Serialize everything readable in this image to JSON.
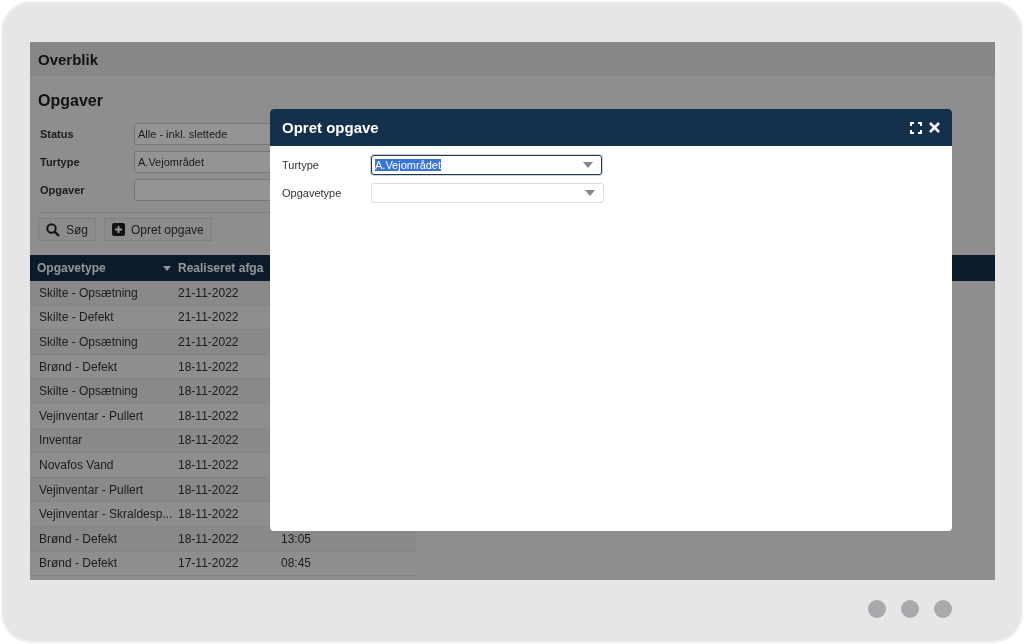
{
  "page": {
    "title": "Overblik",
    "section_title": "Opgaver"
  },
  "filters": [
    {
      "label": "Status",
      "value": "Alle - inkl. slettede"
    },
    {
      "label": "Turtype",
      "value": "A.Vejområdet"
    },
    {
      "label": "Opgaver"
    }
  ],
  "buttons": [
    {
      "label": "Søg",
      "kind": "search"
    },
    {
      "label": "Opret opgave",
      "kind": "add"
    }
  ],
  "table": {
    "columns": [
      {
        "label": "Opgavetype"
      },
      {
        "label": "Realiseret afga"
      }
    ],
    "rows": [
      {
        "opgavetype": "Skilte - Opsætning",
        "date": "21-11-2022"
      },
      {
        "opgavetype": "Skilte - Defekt",
        "date": "21-11-2022"
      },
      {
        "opgavetype": "Skilte - Opsætning",
        "date": "21-11-2022"
      },
      {
        "opgavetype": "Brønd - Defekt",
        "date": "18-11-2022"
      },
      {
        "opgavetype": "Skilte - Opsætning",
        "date": "18-11-2022"
      },
      {
        "opgavetype": "Vejinventar - Pullert",
        "date": "18-11-2022"
      },
      {
        "opgavetype": "Inventar",
        "date": "18-11-2022"
      },
      {
        "opgavetype": "Novafos Vand",
        "date": "18-11-2022"
      },
      {
        "opgavetype": "Vejinventar - Pullert",
        "date": "18-11-2022"
      },
      {
        "opgavetype": "Vejinventar - Skraldesp...",
        "date": "18-11-2022"
      },
      {
        "opgavetype": "Brønd - Defekt",
        "date": "18-11-2022",
        "column_3": "13:05"
      },
      {
        "opgavetype": "Brønd - Defekt",
        "date": "17-11-2022",
        "column_3": "08:45"
      }
    ]
  },
  "dialog": {
    "title": "Opret opgave",
    "fields": [
      {
        "label": "Turtype",
        "value": "A.Vejområdet",
        "focused": true
      },
      {
        "label": "Opgavetype",
        "focused": false
      }
    ]
  }
}
